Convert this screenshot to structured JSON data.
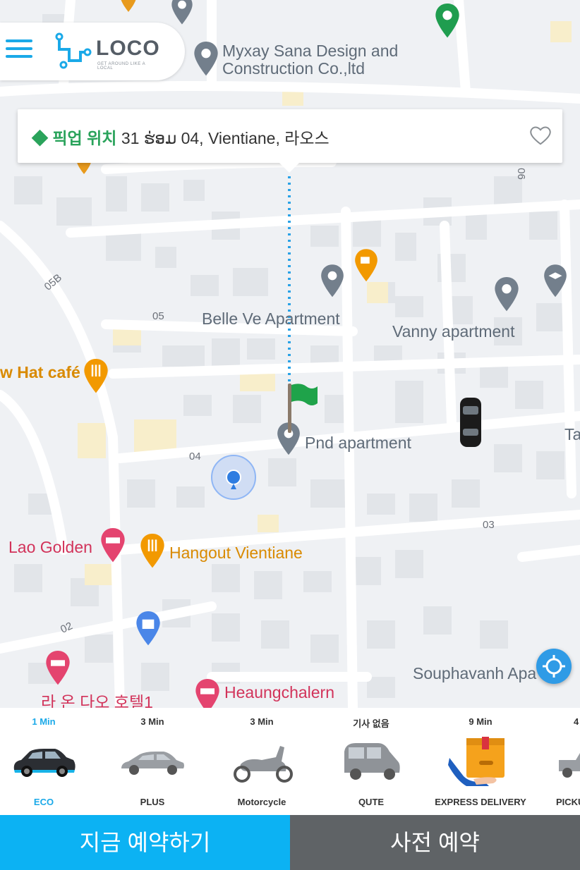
{
  "header": {
    "logo_text": "LOCO",
    "logo_tagline": "GET AROUND LIKE A LOCAL"
  },
  "pickup": {
    "tag": "◆ 픽업 위치",
    "address": "31 ຮ່ອມ 04, Vientiane, 라오스"
  },
  "map": {
    "pois": [
      {
        "name": "Myxay Sana Design and\nConstruction Co.,ltd",
        "color": "#5f6b78"
      },
      {
        "name": "Belle Ve Apartment",
        "color": "#5f6b78"
      },
      {
        "name": "Vanny apartment",
        "color": "#5f6b78"
      },
      {
        "name": "w Hat café",
        "color": "#d98a00"
      },
      {
        "name": "Pnd apartment",
        "color": "#5f6b78"
      },
      {
        "name": "Lao Golden",
        "color": "#d2335a"
      },
      {
        "name": "Hangout Vientiane",
        "color": "#d98a00"
      },
      {
        "name": "Souphavanh Apa",
        "color": "#5f6b78"
      },
      {
        "name": "Heaungchalern",
        "color": "#d2335a"
      },
      {
        "name": "라 온 다오 호텔1",
        "color": "#d2335a"
      },
      {
        "name": "Ta",
        "color": "#5f6b78"
      }
    ],
    "roads": [
      "05B",
      "05",
      "04",
      "03",
      "02",
      "06"
    ]
  },
  "vehicles": [
    {
      "eta": "1 Min",
      "name": "ECO",
      "selected": true,
      "icon": "car-eco-icon"
    },
    {
      "eta": "3 Min",
      "name": "PLUS",
      "selected": false,
      "icon": "car-plus-icon"
    },
    {
      "eta": "3 Min",
      "name": "Motorcycle",
      "selected": false,
      "icon": "motorcycle-icon"
    },
    {
      "eta": "기사 없음",
      "name": "QUTE",
      "selected": false,
      "icon": "qute-icon"
    },
    {
      "eta": "9 Min",
      "name": "EXPRESS DELIVERY",
      "selected": false,
      "icon": "delivery-box-icon"
    },
    {
      "eta": "4",
      "name": "PICKU",
      "selected": false,
      "icon": "pickup-truck-icon"
    }
  ],
  "buttons": {
    "book_now": "지금 예약하기",
    "book_later": "사전 예약"
  },
  "colors": {
    "accent": "#0cb2f3",
    "secondary_button": "#5f6366",
    "pickup_tag": "#2aa35b"
  }
}
